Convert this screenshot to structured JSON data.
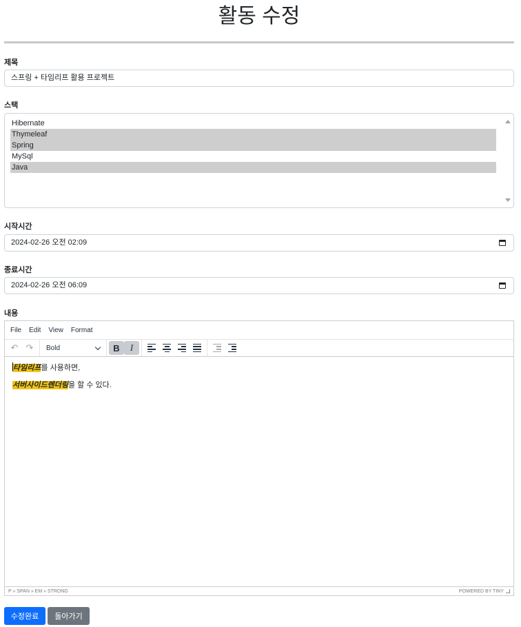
{
  "page": {
    "title": "활동 수정"
  },
  "form": {
    "title_label": "제목",
    "title_value": "스프링 + 타임리프 활용 프로젝트",
    "stack_label": "스택",
    "stack_options": [
      {
        "label": "Hibernate",
        "selected": false
      },
      {
        "label": "Thymeleaf",
        "selected": true
      },
      {
        "label": "Spring",
        "selected": true
      },
      {
        "label": "MySql",
        "selected": false
      },
      {
        "label": "Java",
        "selected": true
      }
    ],
    "start_label": "시작시간",
    "start_value": "2024-02-26 오전 02:09",
    "end_label": "종료시간",
    "end_value": "2024-02-26 오전 06:09",
    "content_label": "내용"
  },
  "editor": {
    "menu": [
      "File",
      "Edit",
      "View",
      "Format"
    ],
    "block_format": "Bold",
    "toolbar_icons": [
      "undo-icon",
      "redo-icon",
      "bold-icon",
      "italic-icon",
      "align-left-icon",
      "align-center-icon",
      "align-right-icon",
      "align-justify-icon",
      "outdent-icon",
      "indent-icon"
    ],
    "bold_glyph": "B",
    "italic_glyph": "I",
    "undo_glyph": "↶",
    "redo_glyph": "↷",
    "line1_highlight": "타임리프",
    "line1_rest": "를 사용하면,",
    "line2_highlight": "서버사이드렌더링",
    "line2_rest": "을 할 수 있다.",
    "highlight_color": "#f1c40f",
    "path": "P » SPAN » EM » STRONG",
    "branding": "POWERED BY TINY"
  },
  "buttons": {
    "submit": "수정완료",
    "back": "돌아가기"
  },
  "colors": {
    "primary": "#0d6efd",
    "secondary": "#6c757d"
  }
}
